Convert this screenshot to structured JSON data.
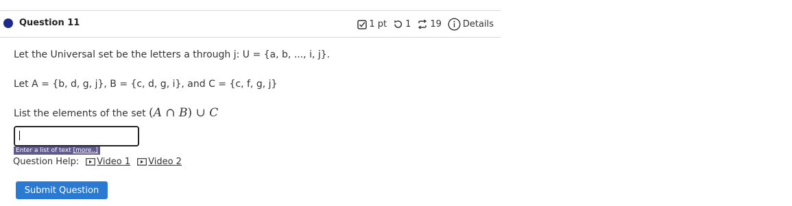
{
  "question": {
    "title": "Question 11",
    "points": "1 pt",
    "attempts": "1",
    "tries": "19",
    "details_label": "Details"
  },
  "content": {
    "line1": "Let the Universal set be the letters a through j: U = {a, b, ..., i, j}.",
    "line2": "Let A = {b, d, g, j}, B = {c, d, g, i}, and C = {c, f, g, j}",
    "line3_prefix": "List the elements of the set ",
    "math": {
      "open": "(",
      "a": "A",
      "cap": " ∩ ",
      "b": "B",
      "close": ")",
      "cup": " ∪ ",
      "c": "C"
    }
  },
  "answer": {
    "value": "",
    "hint": "Enter a list of text",
    "hint_more": "[more..]"
  },
  "help": {
    "label": "Question Help:",
    "videos": [
      "Video 1",
      "Video 2"
    ]
  },
  "submit_label": "Submit Question"
}
